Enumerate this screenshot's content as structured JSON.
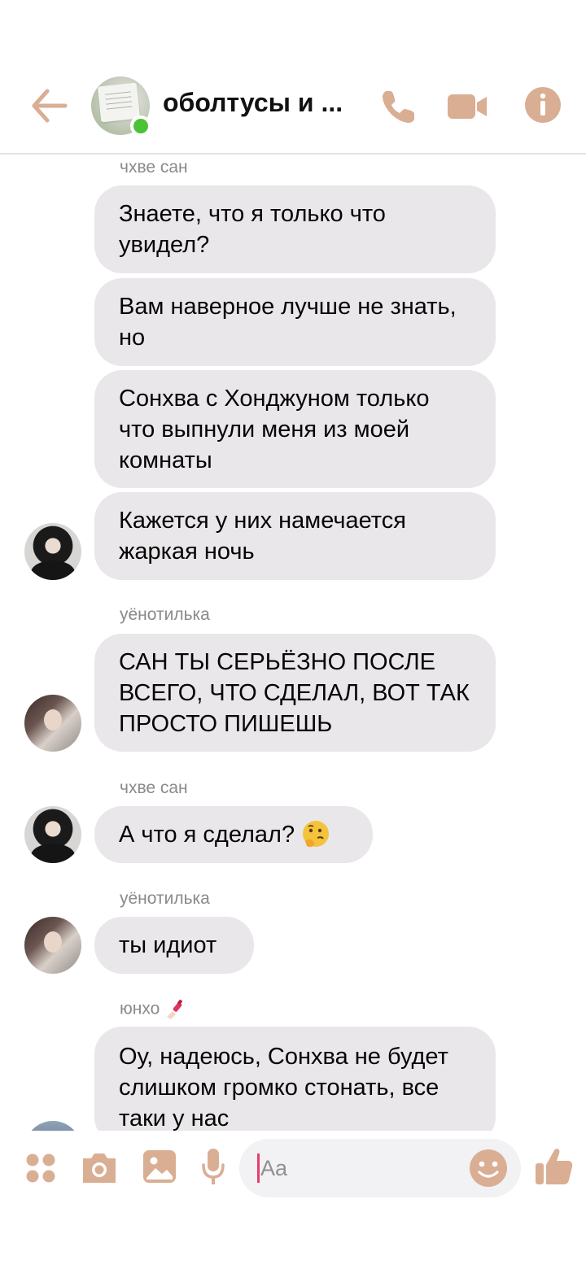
{
  "header": {
    "title": "оболтусы и ...",
    "back_icon": "arrow-left-icon",
    "call_icon": "phone-icon",
    "video_icon": "video-camera-icon",
    "info_icon": "info-icon",
    "accent_color": "#d9ae93",
    "online_color": "#4cc236"
  },
  "chat": {
    "groups": [
      {
        "sender": "чхве сан",
        "messages": [
          "Знаете, что я только что увидел?",
          "Вам наверное лучше не знать, но",
          "Сонхва с Хонджуном только что выпнули меня из моей комнаты",
          "Кажется у них намечается жаркая ночь"
        ]
      },
      {
        "sender": "уёнотилька",
        "messages": [
          "САН ТЫ СЕРЬЁЗНО ПОСЛЕ ВСЕГО, ЧТО СДЕЛАЛ, ВОТ ТАК ПРОСТО ПИШЕШЬ"
        ]
      },
      {
        "sender": "чхве сан",
        "messages": [
          "А что я сделал?"
        ],
        "emoji": "thinking-face-icon"
      },
      {
        "sender": "уёнотилька",
        "messages": [
          "ты идиот"
        ]
      },
      {
        "sender": "юнхо",
        "sender_emoji": "nail-polish-icon",
        "messages": [
          "Оу, надеюсь, Сонхва не будет слишком громко стонать, все таки у нас"
        ]
      }
    ]
  },
  "composer": {
    "placeholder": "Aa",
    "apps_icon": "apps-grid-icon",
    "camera_icon": "camera-icon",
    "gallery_icon": "image-icon",
    "mic_icon": "microphone-icon",
    "emoji_icon": "smile-icon",
    "like_icon": "thumbs-up-icon"
  }
}
